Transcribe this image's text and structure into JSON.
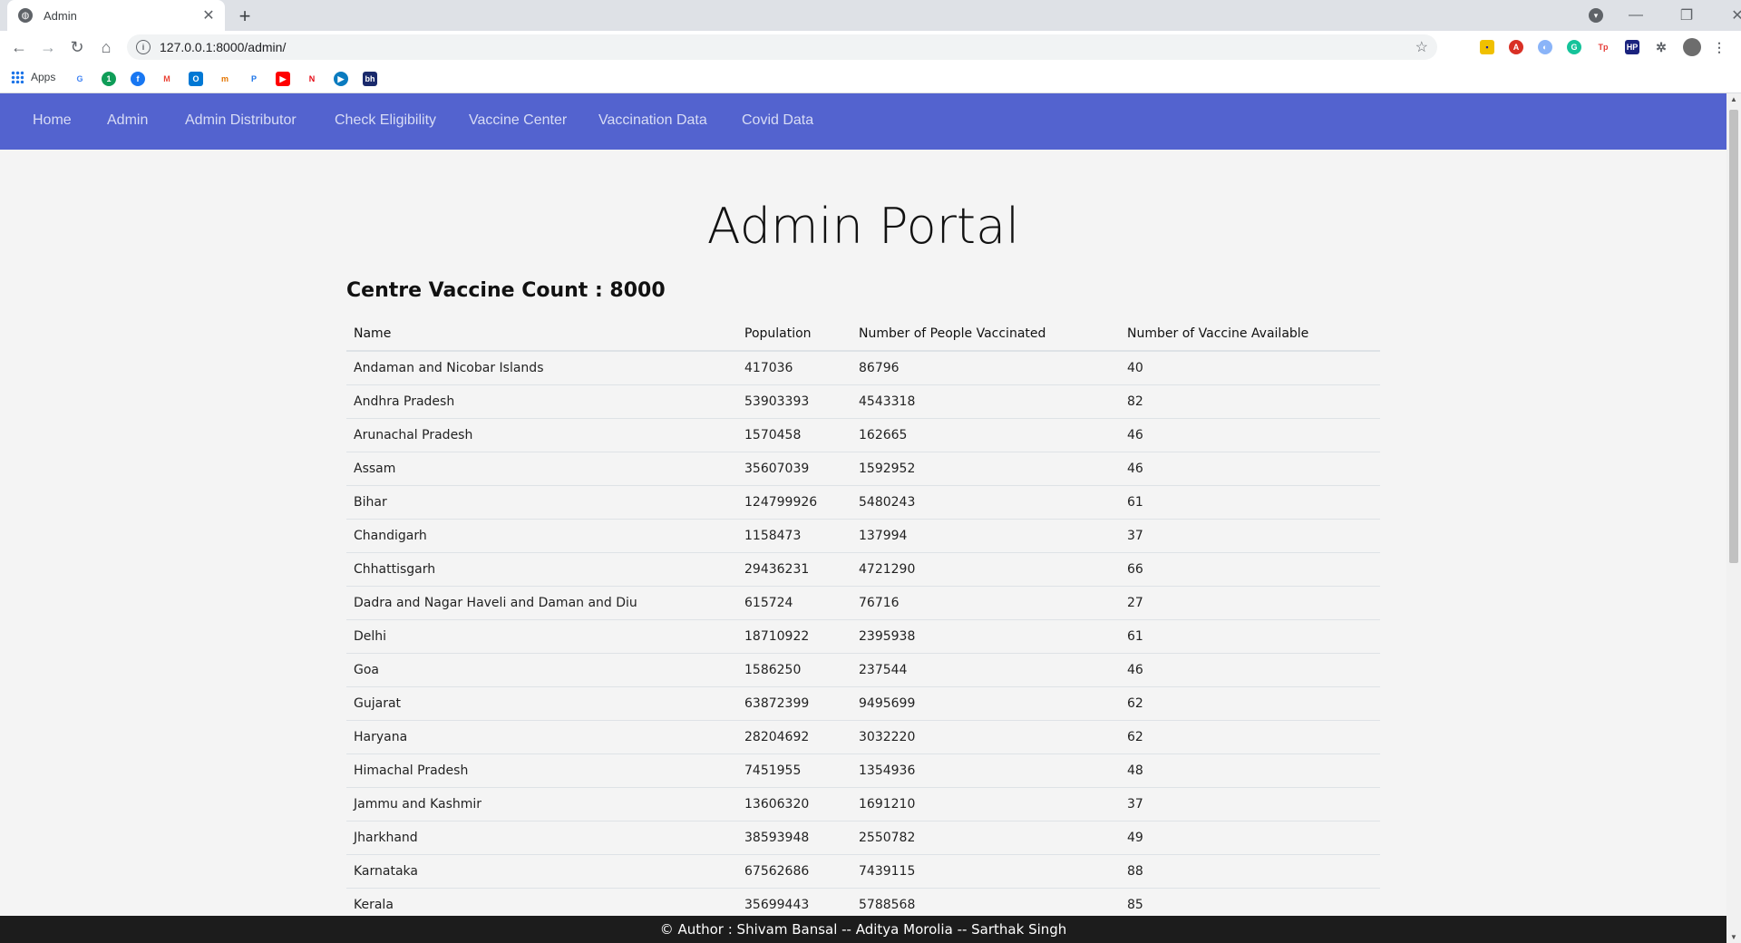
{
  "browser": {
    "tab_title": "Admin",
    "url": "127.0.0.1:8000/admin/",
    "bookmarks_apps_label": "Apps"
  },
  "nav": {
    "links": [
      "Home",
      "Admin",
      "Admin Distributor",
      "Check Eligibility",
      "Vaccine Center",
      "Vaccination Data",
      "Covid Data"
    ]
  },
  "page": {
    "title": "Admin Portal",
    "count_label": "Centre Vaccine Count : 8000"
  },
  "table": {
    "headers": [
      "Name",
      "Population",
      "Number of People Vaccinated",
      "Number of Vaccine Available"
    ],
    "rows": [
      [
        "Andaman and Nicobar Islands",
        "417036",
        "86796",
        "40"
      ],
      [
        "Andhra Pradesh",
        "53903393",
        "4543318",
        "82"
      ],
      [
        "Arunachal Pradesh",
        "1570458",
        "162665",
        "46"
      ],
      [
        "Assam",
        "35607039",
        "1592952",
        "46"
      ],
      [
        "Bihar",
        "124799926",
        "5480243",
        "61"
      ],
      [
        "Chandigarh",
        "1158473",
        "137994",
        "37"
      ],
      [
        "Chhattisgarh",
        "29436231",
        "4721290",
        "66"
      ],
      [
        "Dadra and Nagar Haveli and Daman and Diu",
        "615724",
        "76716",
        "27"
      ],
      [
        "Delhi",
        "18710922",
        "2395938",
        "61"
      ],
      [
        "Goa",
        "1586250",
        "237544",
        "46"
      ],
      [
        "Gujarat",
        "63872399",
        "9495699",
        "62"
      ],
      [
        "Haryana",
        "28204692",
        "3032220",
        "62"
      ],
      [
        "Himachal Pradesh",
        "7451955",
        "1354936",
        "48"
      ],
      [
        "Jammu and Kashmir",
        "13606320",
        "1691210",
        "37"
      ],
      [
        "Jharkhand",
        "38593948",
        "2550782",
        "49"
      ],
      [
        "Karnataka",
        "67562686",
        "7439115",
        "88"
      ],
      [
        "Kerala",
        "35699443",
        "5788568",
        "85"
      ]
    ]
  },
  "footer": {
    "text": "© Author : Shivam Bansal -- Aditya Morolia -- Sarthak Singh"
  }
}
